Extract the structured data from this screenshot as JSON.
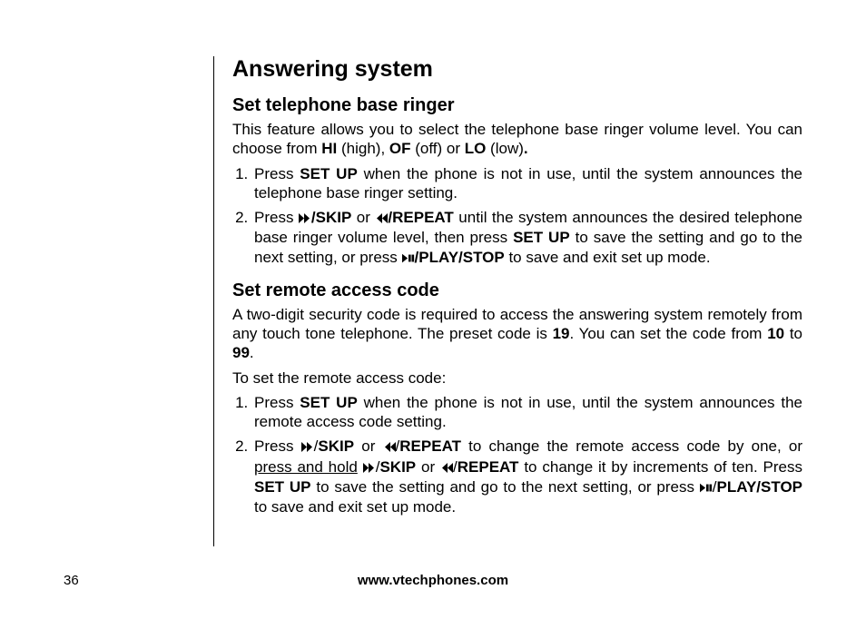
{
  "page": {
    "number": "36",
    "footer_url": "www.vtechphones.com"
  },
  "title": "Answering system",
  "section1": {
    "heading": "Set telephone base ringer",
    "intro_a": "This feature allows you to select the telephone base ringer volume level. You can choose from ",
    "hi": "HI",
    "intro_b": " (high), ",
    "of": "OF",
    "intro_c": " (off) or ",
    "lo": "LO",
    "intro_d": " (low)",
    "intro_e": ".",
    "step1_a": "Press ",
    "setup": "SET UP",
    "step1_b": " when the phone is not in use, until the system announces the telephone base ringer setting.",
    "step2_a": "Press ",
    "skip": "/SKIP",
    "step2_b": " or ",
    "repeat": "/REPEAT",
    "step2_c": " until the system announces the desired telephone base ringer volume level, then press ",
    "step2_d": " to save the setting and go to the next setting, or press ",
    "playstop": "/PLAY/STOP",
    "step2_e": " to save and exit set up mode."
  },
  "section2": {
    "heading": "Set remote access code",
    "intro_a": "A two-digit security code is required to access the answering system remotely from any touch tone telephone. The preset code is ",
    "code_default": "19",
    "intro_b": ". You can set the code from ",
    "code_min": "10",
    "intro_c": " to ",
    "code_max": "99",
    "intro_d": ".",
    "lead": "To set the remote access code:",
    "step1_a": "Press ",
    "step1_b": " when the phone is not in use, until the system announces the remote access code setting.",
    "step2_a": "Press ",
    "step2_b": " or ",
    "step2_c": " to change the remote access code by one, or ",
    "press_hold": "press and hold",
    "step2_d": " ",
    "step2_e": " or ",
    "step2_f": " to change it by increments of ten. Press ",
    "step2_g": " to save the setting and go to the next setting, or press ",
    "step2_h": " to save and exit set up mode."
  }
}
